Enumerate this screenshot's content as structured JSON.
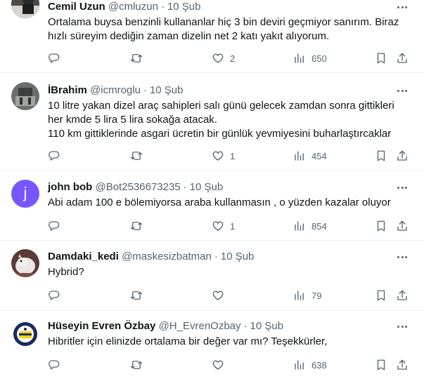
{
  "tweets": [
    {
      "name": "Cemil Uzun",
      "handle": "@cmluzun",
      "date": "10 Şub",
      "lines": [
        "Ortalama buysa benzinli kullananlar hiç 3 bin deviri geçmiyor sanırım. Biraz",
        "hızlı süreyim dediğin zaman dizelin net 2 katı yakıt alıyorum."
      ],
      "likes": "2",
      "views": "650"
    },
    {
      "name": "İBrahim",
      "handle": "@icmroglu",
      "date": "10 Şub",
      "lines": [
        "10 litre yakan dizel araç sahipleri salı günü gelecek zamdan sonra gittikleri",
        "her kmde 5 lira 5 lira sokağa atacak.",
        "110 km gittiklerinde asgari ücretin bir günlük yevmiyesini buharlaştırcaklar"
      ],
      "likes": "1",
      "views": "454"
    },
    {
      "name": "john bob",
      "handle": "@Bot2536673235",
      "date": "10 Şub",
      "avatar_letter": "j",
      "lines": [
        "Abi adam 100 e bölemiyorsa araba kullanmasın , o yüzden kazalar oluyor"
      ],
      "likes": "1",
      "views": "854"
    },
    {
      "name": "Damdaki_kedi",
      "handle": "@maskesizbatman",
      "date": "10 Şub",
      "lines": [
        "Hybrid?"
      ],
      "likes": "",
      "views": "79"
    },
    {
      "name": "Hüseyin Evren Özbay",
      "handle": "@H_EvrenOzbay",
      "date": "10 Şub",
      "lines": [
        "Hibritler için elinizde ortalama bir değer var mı? Teşekkürler,"
      ],
      "likes": "",
      "views": "638"
    }
  ],
  "colors": {
    "text": "#0f1419",
    "secondary": "#536471",
    "divider": "#eff3f4",
    "avatar_purple": "#7856ff"
  },
  "icons": [
    "reply-icon",
    "retweet-icon",
    "like-icon",
    "views-icon",
    "bookmark-icon",
    "share-icon",
    "more-icon"
  ]
}
